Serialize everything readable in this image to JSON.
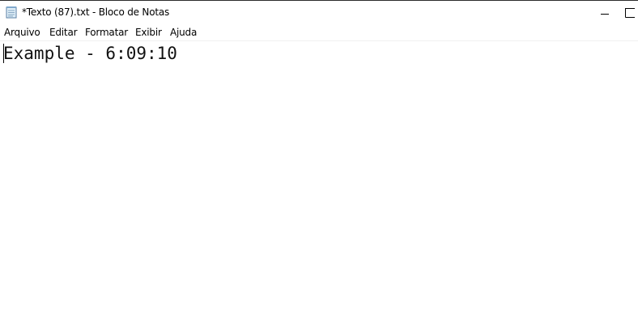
{
  "window": {
    "title": "*Texto (87).txt - Bloco de Notas",
    "app_icon": "notepad-icon"
  },
  "controls": {
    "minimize_icon": "minimize-icon",
    "maximize_icon": "maximize-icon"
  },
  "menu": {
    "items": [
      {
        "label": "Arquivo"
      },
      {
        "label": "Editar"
      },
      {
        "label": "Formatar"
      },
      {
        "label": "Exibir"
      },
      {
        "label": "Ajuda"
      }
    ]
  },
  "editor": {
    "content": "Example - 6:09:10"
  }
}
